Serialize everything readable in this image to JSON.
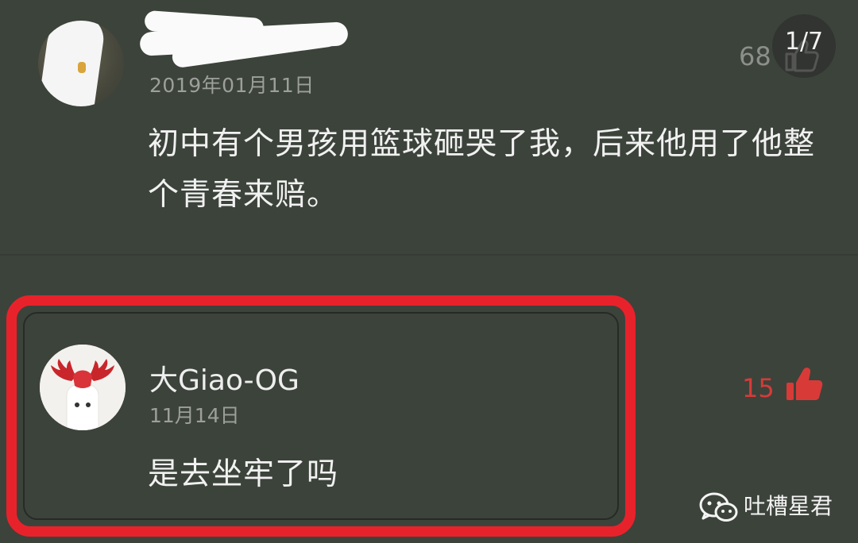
{
  "comment": {
    "date": "2019年01月11日",
    "like_count": "68",
    "content": "初中有个男孩用篮球砸哭了我，后来他用了他整个青春来赔。"
  },
  "page_indicator": "1/7",
  "reply": {
    "username": "大Giao-OG",
    "date": "11月14日",
    "like_count": "15",
    "content": "是去坐牢了吗"
  },
  "watermark": {
    "icon": "wechat-icon",
    "text": "吐槽星君"
  },
  "colors": {
    "background": "#3c433b",
    "highlight_border": "#e8222b",
    "liked_accent": "#d83a38"
  }
}
